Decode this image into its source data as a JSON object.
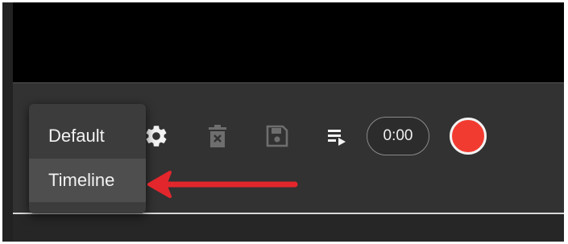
{
  "recording_toolbar": {
    "icons": {
      "settings": "gear-icon",
      "delete": "trash-icon",
      "save": "save-icon",
      "playlist": "playlist-play-icon"
    },
    "timer": "0:00",
    "record_color": "#f23b30"
  },
  "view_menu": {
    "items": [
      {
        "label": "Default",
        "highlighted": false
      },
      {
        "label": "Timeline",
        "highlighted": true
      }
    ]
  },
  "annotation": {
    "arrow_color": "#e3262c",
    "points_to": "Timeline"
  }
}
